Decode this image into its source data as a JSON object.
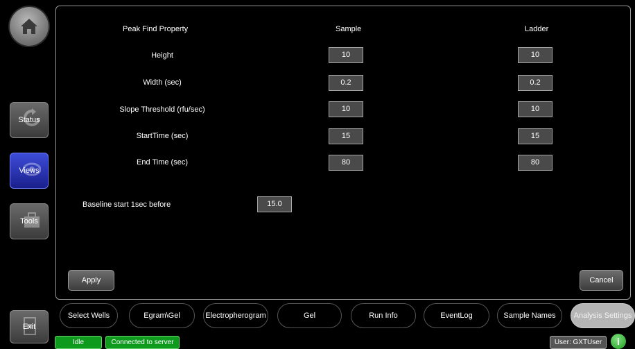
{
  "nav": {
    "status_label": "Status",
    "views_label": "Views",
    "tools_label": "Tools",
    "exit_label": "Exit"
  },
  "table": {
    "headers": {
      "property": "Peak Find Property",
      "sample": "Sample",
      "ladder": "Ladder"
    },
    "rows": [
      {
        "label": "Height",
        "sample": "10",
        "ladder": "10"
      },
      {
        "label": "Width (sec)",
        "sample": "0.2",
        "ladder": "0.2"
      },
      {
        "label": "Slope Threshold (rfu/sec)",
        "sample": "10",
        "ladder": "10"
      },
      {
        "label": "StartTime (sec)",
        "sample": "15",
        "ladder": "15"
      },
      {
        "label": "End Time (sec)",
        "sample": "80",
        "ladder": "80"
      }
    ]
  },
  "baseline": {
    "label": "Baseline start 1sec before",
    "value": "15.0"
  },
  "actions": {
    "apply_label": "Apply",
    "cancel_label": "Cancel"
  },
  "tabs": [
    {
      "label": "Select Wells"
    },
    {
      "label": "Egram\\Gel"
    },
    {
      "label": "Electropherogram"
    },
    {
      "label": "Gel"
    },
    {
      "label": "Run Info"
    },
    {
      "label": "EventLog"
    },
    {
      "label": "Sample Names"
    },
    {
      "label": "Analysis Settings",
      "active": true
    }
  ],
  "statusbar": {
    "state": "Idle",
    "connection": "Connected to server",
    "user": "User: GXTUser"
  },
  "colors": {
    "active_nav": "#2a35c8",
    "status_green": "#0d9a1d"
  }
}
